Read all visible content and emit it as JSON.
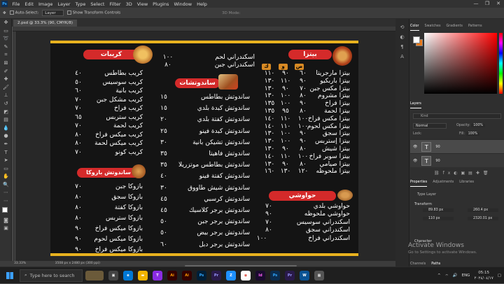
{
  "menubar": {
    "app_icon": "Ps",
    "items": [
      "File",
      "Edit",
      "Image",
      "Layer",
      "Type",
      "Select",
      "Filter",
      "3D",
      "View",
      "Plugins",
      "Window",
      "Help"
    ]
  },
  "window_controls": [
    "—",
    "❐",
    "✕"
  ],
  "options_bar": {
    "auto_select_label": "Auto-Select:",
    "layer_dropdown": "Layer",
    "show_transform_label": "Show Transform Controls",
    "mode_3d": "3D Mode:"
  },
  "document": {
    "tab_title": "2.psd @ 33.3% (90, CMYK/8)",
    "zoom": "33.33%",
    "doc_info": "3508 px x 2480 px (300 ppi)"
  },
  "menu": {
    "pizza_title": "بيتزا",
    "sizes": [
      "ص",
      "و",
      "ك"
    ],
    "pizza_items": [
      {
        "name": "بيتزا مارجريتا",
        "p": [
          "٦٠",
          "٩٠",
          "١١٠"
        ]
      },
      {
        "name": "بيتزا باربكيو",
        "p": [
          "٩٠",
          "١١٠",
          "١٣٠"
        ]
      },
      {
        "name": "بيتزا مكس جبن",
        "p": [
          "٧٠",
          "٩٠",
          "١٣٠"
        ]
      },
      {
        "name": "بيتزا مشروم",
        "p": [
          "٨٠",
          "١٠٠",
          "١٣٠"
        ]
      },
      {
        "name": "بيتزا فراخ",
        "p": [
          "٩٠",
          "١٠٠",
          "١٣٥"
        ]
      },
      {
        "name": "بيتزا لحمة",
        "p": [
          "٨٠",
          "٩٥",
          "١٣٥"
        ]
      },
      {
        "name": "بيتزا مكس فراخ",
        "p": [
          "١٠٠",
          "١١٠",
          "١٤٠"
        ]
      },
      {
        "name": "بيتزا مكس لحوم",
        "p": [
          "١٠٠",
          "١١٠",
          "١٤٠"
        ]
      },
      {
        "name": "بيتزا سجق",
        "p": [
          "٩٠",
          "١٠٠",
          "١٣٠"
        ]
      },
      {
        "name": "بيتزا إستربس",
        "p": [
          "٩٠",
          "١٠٠",
          "١٣٠"
        ]
      },
      {
        "name": "بيتزا شيش",
        "p": [
          "٨٠",
          "٩٠",
          "١٣٠"
        ]
      },
      {
        "name": "بيتزا سوبر فراخ",
        "p": [
          "١٠٠",
          "١١٠",
          "١٤٠"
        ]
      },
      {
        "name": "بيتزا صيامي",
        "p": [
          "٨٠",
          "٩٠",
          "١٣٠"
        ]
      },
      {
        "name": "بيتزا ملحوظه",
        "p": [
          "١٢٠",
          "١٣٠",
          "١٦٠"
        ]
      }
    ],
    "hawawshi_title": "حواوشي",
    "hawawshi_items": [
      {
        "name": "حواوشي بلدي",
        "p": "٧٠"
      },
      {
        "name": "حواوشي ملحوظه",
        "p": "٩٠"
      },
      {
        "name": "اسكندراني سوسيس",
        "p": "٧٠"
      },
      {
        "name": "اسكندراني سجق",
        "p": "٨٠"
      },
      {
        "name": "اسكندراني فراخ",
        "p": "١٠٠"
      }
    ],
    "alex_items": [
      {
        "name": "اسكندراني لحم",
        "p": "١٠٠"
      },
      {
        "name": "اسكندراني جبن",
        "p": "٨٠"
      }
    ],
    "sandwich_title": "ساندوتشات",
    "sandwich_items": [
      {
        "name": "ساندوتش بطاطس",
        "p": "١٥"
      },
      {
        "name": "ساندوتش كبدة بلدي",
        "p": "١٥"
      },
      {
        "name": "ساندوتش كفتة بلدي",
        "p": "٢٠"
      },
      {
        "name": "ساندوتش كبدة فينو",
        "p": "٢٥"
      },
      {
        "name": "ساندوتش تشيكن بانية",
        "p": "٣٠"
      },
      {
        "name": "ساندوتش فاهيتا",
        "p": "٣٥"
      },
      {
        "name": "ساندوتش بطاطس موتزريلا",
        "p": "٣٥"
      },
      {
        "name": "ساندوتش كفتة فينو",
        "p": "٤٠"
      },
      {
        "name": "ساندوتش شيش طاووق",
        "p": "٣٠"
      },
      {
        "name": "ساندوتش كرسبي",
        "p": "٤٥"
      },
      {
        "name": "ساندوتش برجر كلاسيك",
        "p": "٤٥"
      },
      {
        "name": "ساندوتش برجر جبن",
        "p": "٥٠"
      },
      {
        "name": "ساندوتش برجر بيض",
        "p": "٥٠"
      },
      {
        "name": "ساندوتش برجر دبل",
        "p": "٦٠"
      }
    ],
    "crepe_title": "كريبات",
    "crepe_items": [
      {
        "name": "كريب بطاطس",
        "p": "٤٠"
      },
      {
        "name": "كريب سوسيس",
        "p": "٥٠"
      },
      {
        "name": "كريب بانية",
        "p": "٦٠"
      },
      {
        "name": "كريب مشكل جبن",
        "p": "٧٠"
      },
      {
        "name": "كريب فراخ",
        "p": "٧٠"
      },
      {
        "name": "كريب ستربس",
        "p": "٦٥"
      },
      {
        "name": "كريب لحمة",
        "p": "٧٠"
      },
      {
        "name": "كريب ميكس فراخ",
        "p": "٨٠"
      },
      {
        "name": "كريب ميكس لحمة",
        "p": "٨٠"
      },
      {
        "name": "كريب كونو",
        "p": "٧٠"
      }
    ],
    "bazoka_title": "ساندوتش بازوكا",
    "bazoka_items": [
      {
        "name": "بازوكا جبن",
        "p": "٧٠"
      },
      {
        "name": "بازوكا سجق",
        "p": "٨٠"
      },
      {
        "name": "بازوكا كفتة",
        "p": "٨٠"
      },
      {
        "name": "بازوكا ستربس",
        "p": "٨٠"
      },
      {
        "name": "بازوكا ميكس فراخ",
        "p": "٩٠"
      },
      {
        "name": "بازوكا ميكس لحوم",
        "p": "٩٠"
      },
      {
        "name": "بازوكا ميكس فراخ",
        "p": "٩٠"
      }
    ]
  },
  "right_panel": {
    "color_tabs": [
      "Color",
      "Swatches",
      "Gradients",
      "Patterns"
    ],
    "layers_tabs": [
      "Layers",
      "Channels",
      "Paths"
    ],
    "kind_label": "Kind",
    "blend_mode": "Normal",
    "opacity_label": "Opacity:",
    "opacity": "100%",
    "lock_label": "Lock:",
    "fill_label": "Fill:",
    "fill": "100%",
    "layers": [
      {
        "name": "90",
        "type": "T"
      },
      {
        "name": "90",
        "type": "T"
      }
    ],
    "props_tabs": [
      "Properties",
      "Adjustments",
      "Libraries"
    ],
    "type_layer": "Type Layer",
    "transform_label": "Transform",
    "w": "89.83 px",
    "h": "110 px",
    "x": "260.4 px",
    "y": "2320.01 px",
    "character_label": "Character",
    "bottom_tabs": [
      "Channels",
      "Paths"
    ]
  },
  "activate": {
    "title": "Activate Windows",
    "sub": "Go to Settings to activate Windows."
  },
  "taskbar": {
    "search_placeholder": "Type here to search",
    "time": "05:15",
    "date": "٢٠٢٤/٠٤/١٧",
    "lang": "ENG"
  },
  "colors": {
    "accent_gold": "#e8b21f",
    "pill_red": "#d42a2a",
    "size_orange": "#d88a24",
    "fg": "#ffffff",
    "bg": "#e87a1a"
  }
}
